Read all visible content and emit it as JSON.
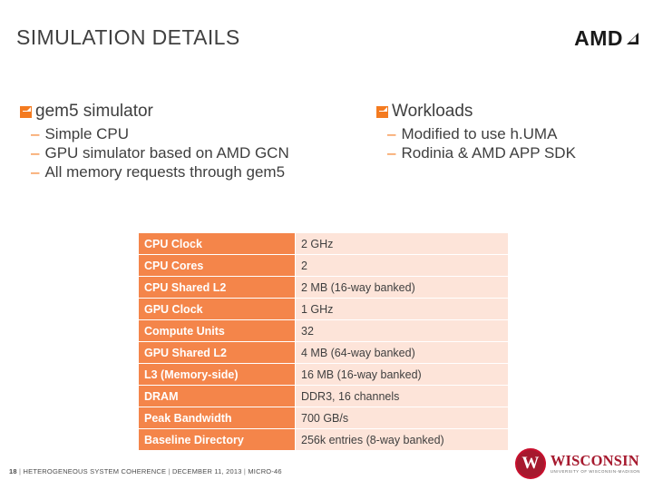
{
  "slide": {
    "title": "SIMULATION DETAILS",
    "page_number": "18"
  },
  "brand": {
    "amd_text": "AMD",
    "amd_arrow_icon": "arrow-up-right-icon"
  },
  "bullets": {
    "left": {
      "heading": "gem5 simulator",
      "items": [
        "Simple CPU",
        "GPU simulator based on AMD GCN",
        "All memory requests through gem5"
      ]
    },
    "right": {
      "heading": "Workloads",
      "items": [
        "Modified to use h.UMA",
        "Rodinia & AMD APP SDK"
      ]
    }
  },
  "table": {
    "rows": [
      {
        "label": "CPU Clock",
        "value": "2 GHz"
      },
      {
        "label": "CPU Cores",
        "value": "2"
      },
      {
        "label": "CPU Shared L2",
        "value": "2 MB (16-way banked)"
      },
      {
        "label": "GPU Clock",
        "value": "1 GHz"
      },
      {
        "label": "Compute Units",
        "value": "32"
      },
      {
        "label": "GPU Shared L2",
        "value": "4 MB (64-way banked)"
      },
      {
        "label": "L3 (Memory-side)",
        "value": "16 MB (16-way banked)"
      },
      {
        "label": "DRAM",
        "value": "DDR3, 16 channels"
      },
      {
        "label": "Peak Bandwidth",
        "value": "700 GB/s"
      },
      {
        "label": "Baseline Directory",
        "value": "256k entries (8-way banked)"
      }
    ]
  },
  "footer": {
    "page": "18",
    "sep": "|",
    "deck_title": "HETEROGENEOUS SYSTEM COHERENCE",
    "date": "DECEMBER 11, 2013",
    "venue": "MICRO-46"
  },
  "wisconsin": {
    "crest_letter": "W",
    "name": "WISCONSIN",
    "tagline": "UNIVERSITY OF WISCONSIN-MADISON"
  },
  "colors": {
    "accent_orange": "#f47b20",
    "table_label_bg": "#f4854a",
    "table_value_bg": "#fde4d9",
    "title_gray": "#404040",
    "wisconsin_red": "#a6192e"
  }
}
